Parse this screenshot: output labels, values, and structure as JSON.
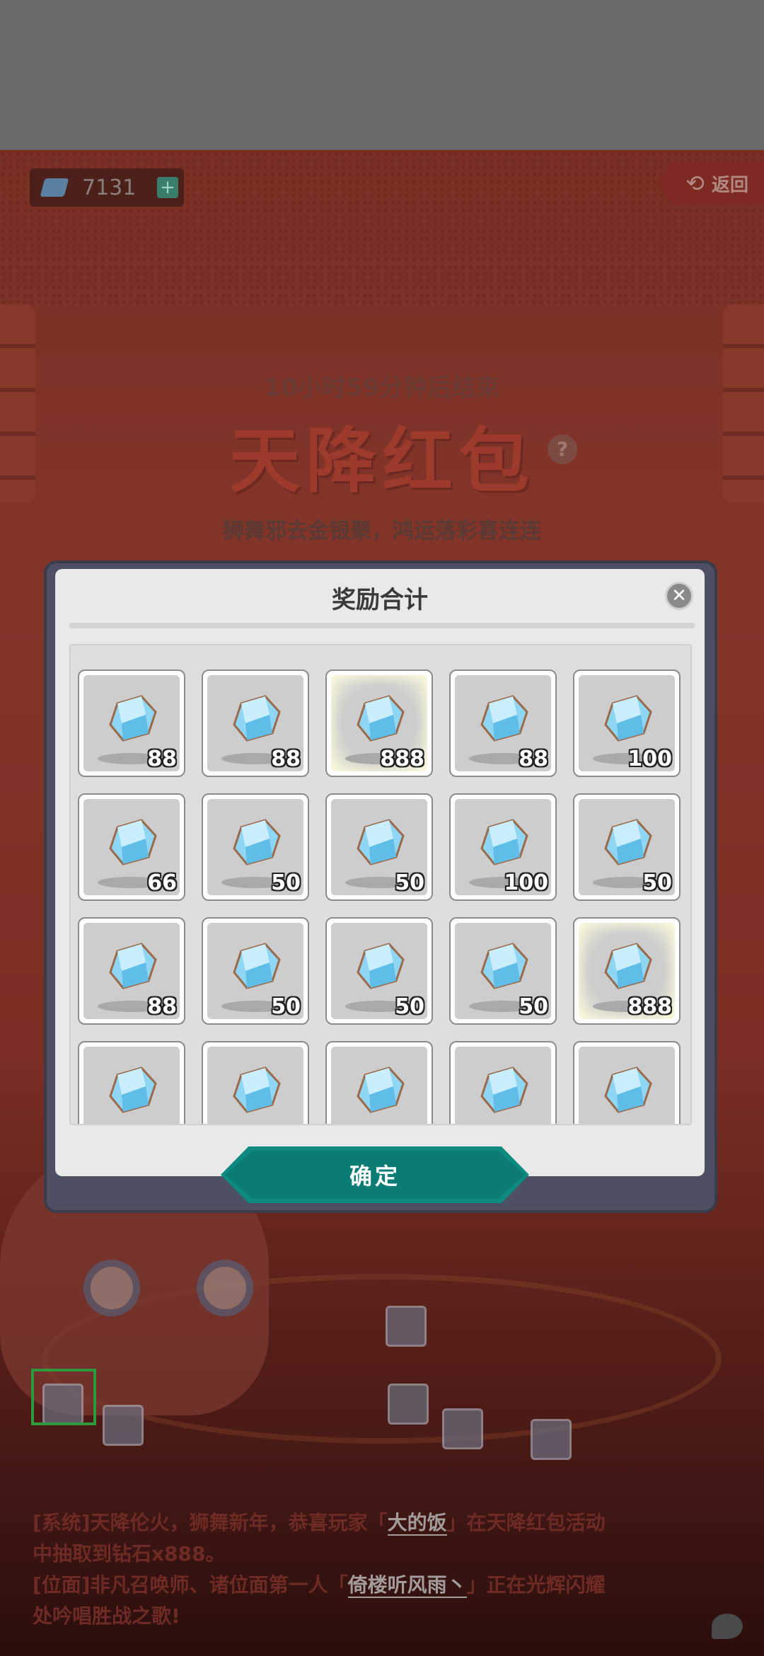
{
  "background": {
    "currency_count": "7131",
    "currency_plus": "+",
    "back_arrow": "⟲",
    "back_label": "返回",
    "timer": "10小时59分钟后结束",
    "event_title": "天降红包",
    "help": "?",
    "subtitle": "狮舞邪去金银聚，鸿运落彩喜连连",
    "log_line1_a": "[系统]天降伦火，狮舞新年，恭喜玩家「",
    "log_line1_name": "大的饭",
    "log_line1_b": "」在天降红包活动",
    "log_line2": "中抽取到钻石x888。",
    "log_line3_a": "[位面]非凡召唤师、诸位面第一人「",
    "log_line3_name": "倚楼听风雨丶",
    "log_line3_b": "」正在光辉闪耀",
    "log_line4": "处吟唱胜战之歌!"
  },
  "modal": {
    "title": "奖励合计",
    "close": "✕",
    "confirm_label": "确定",
    "rewards": [
      {
        "icon": "diamond-icon",
        "qty": "88",
        "glow": false
      },
      {
        "icon": "diamond-icon",
        "qty": "88",
        "glow": false
      },
      {
        "icon": "diamond-icon",
        "qty": "888",
        "glow": true
      },
      {
        "icon": "diamond-icon",
        "qty": "88",
        "glow": false
      },
      {
        "icon": "diamond-icon",
        "qty": "100",
        "glow": false
      },
      {
        "icon": "diamond-icon",
        "qty": "66",
        "glow": false
      },
      {
        "icon": "diamond-icon",
        "qty": "50",
        "glow": false
      },
      {
        "icon": "diamond-icon",
        "qty": "50",
        "glow": false
      },
      {
        "icon": "diamond-icon",
        "qty": "100",
        "glow": false
      },
      {
        "icon": "diamond-icon",
        "qty": "50",
        "glow": false
      },
      {
        "icon": "diamond-icon",
        "qty": "88",
        "glow": false
      },
      {
        "icon": "diamond-icon",
        "qty": "50",
        "glow": false
      },
      {
        "icon": "diamond-icon",
        "qty": "50",
        "glow": false
      },
      {
        "icon": "diamond-icon",
        "qty": "50",
        "glow": false
      },
      {
        "icon": "diamond-icon",
        "qty": "888",
        "glow": true
      },
      {
        "icon": "diamond-icon",
        "qty": "",
        "glow": false
      },
      {
        "icon": "diamond-icon",
        "qty": "",
        "glow": false
      },
      {
        "icon": "diamond-icon",
        "qty": "",
        "glow": false
      },
      {
        "icon": "diamond-icon",
        "qty": "",
        "glow": false
      },
      {
        "icon": "diamond-icon",
        "qty": "",
        "glow": false
      }
    ]
  },
  "colors": {
    "modal_frame": "#4d5062",
    "confirm": "#0e8a80",
    "diamond": "#8fd6f5"
  }
}
